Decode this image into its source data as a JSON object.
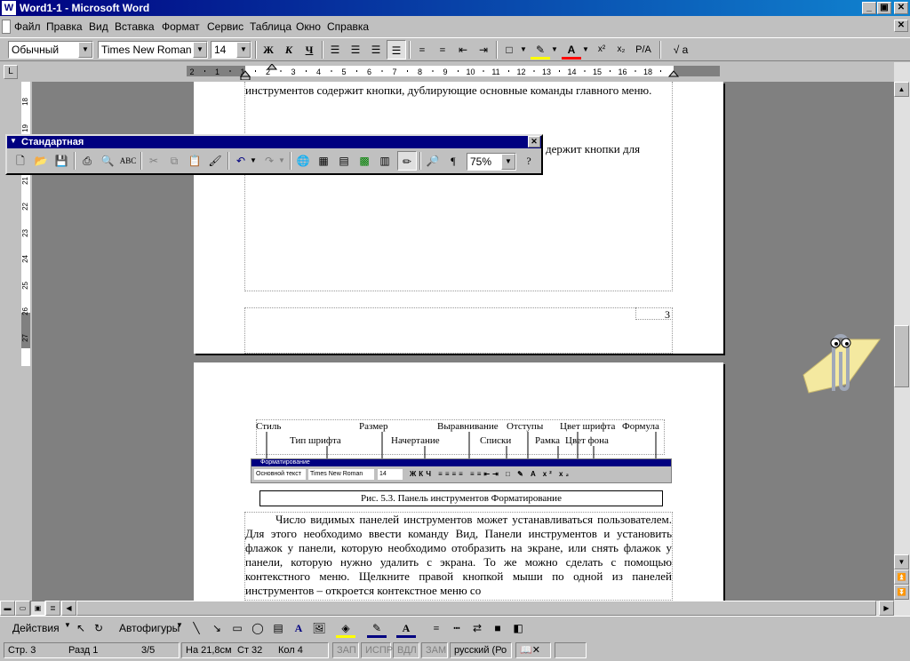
{
  "window": {
    "title": "Word1-1 - Microsoft Word",
    "min": "_",
    "restore": "▣",
    "close": "✕",
    "doc_close": "✕"
  },
  "menu": [
    "Файл",
    "Правка",
    "Вид",
    "Вставка",
    "Формат",
    "Сервис",
    "Таблица",
    "Окно",
    "Справка"
  ],
  "formatting": {
    "style": "Обычный",
    "font": "Times New Roman",
    "size": "14",
    "bold": "Ж",
    "italic": "К",
    "underline": "Ч",
    "superscript": "x²",
    "subscript": "x₂",
    "pa": "P/A",
    "formula": "√ a"
  },
  "standard_toolbar": {
    "title": "Стандартная",
    "zoom": "75%"
  },
  "ruler": {
    "ticks": [
      "2",
      "1",
      "1",
      "2",
      "3",
      "4",
      "5",
      "6",
      "7",
      "8",
      "9",
      "10",
      "11",
      "12",
      "13",
      "14",
      "15",
      "16",
      "18"
    ],
    "vticks": [
      "18",
      "19",
      "20",
      "21",
      "22",
      "23",
      "24",
      "25",
      "26",
      "27"
    ]
  },
  "page1": {
    "text1": "инструментов содержит кнопки, дублирующие основные команды главного меню.",
    "text2": "держит кнопки для",
    "page_number": "3"
  },
  "figure": {
    "top_labels": [
      "Стиль",
      "Размер",
      "Выравнивание",
      "Отступы",
      "Цвет шрифта",
      "Формула"
    ],
    "bottom_labels": [
      "Тип шрифта",
      "Начертание",
      "Списки",
      "Рамка",
      "Цвет фона"
    ],
    "bar_title": "Форматирование",
    "bar_style": "Основной текст",
    "bar_font": "Times New Roman",
    "bar_size": "14",
    "caption": "Рис. 5.3. Панель инструментов Форматирование"
  },
  "page2": {
    "paragraph": "Число видимых панелей инструментов может устанавливаться пользователем. Для этого необходимо ввести команду Вид, Панели инструментов и установить флажок у панели, которую необходимо отобразить на экране, или снять флажок у панели, которую нужно удалить с экрана. То же можно сделать с помощью контекстного меню. Щелкните правой кнопкой мыши по одной из панелей инструментов – откроется контекстное меню со"
  },
  "drawing": {
    "actions": "Действия",
    "autoshapes": "Автофигуры"
  },
  "status": {
    "page": "Стр. 3",
    "section": "Разд 1",
    "pages": "3/5",
    "at": "На 21,8см",
    "line": "Ст 32",
    "col": "Кол 4",
    "rec": "ЗАП",
    "trk": "ИСПР",
    "ext": "ВДЛ",
    "ovr": "ЗАМ",
    "lang": "русский (Ро"
  }
}
